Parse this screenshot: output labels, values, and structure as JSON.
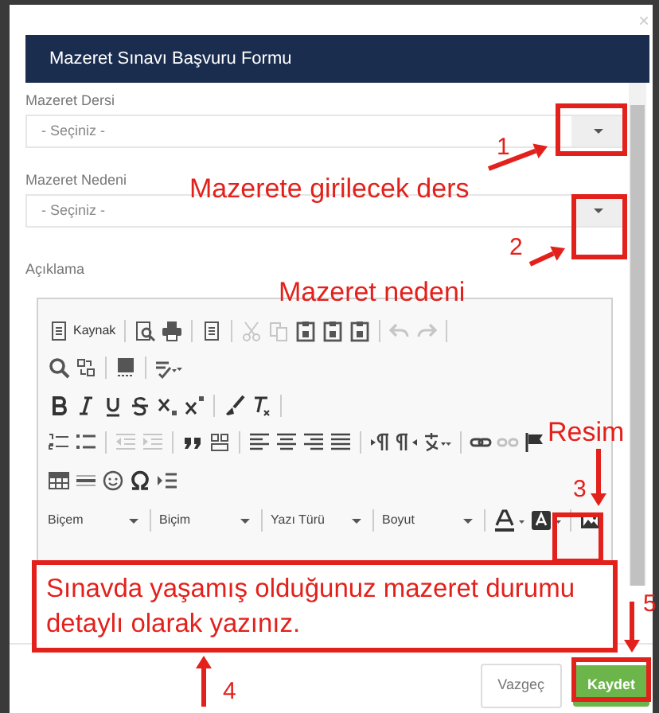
{
  "modal": {
    "close": "×",
    "title": "Mazeret Sınavı Başvuru Formu"
  },
  "fields": [
    {
      "label": "Mazeret Dersi",
      "placeholder": "- Seçiniz -"
    },
    {
      "label": "Mazeret Nedeni",
      "placeholder": "- Seçiniz -"
    }
  ],
  "editor": {
    "label": "Açıklama",
    "toolbar": [
      {
        "items": [
          {
            "kind": "button",
            "label": "Kaynak",
            "disabled": false
          },
          {
            "kind": "sep"
          },
          {
            "kind": "icon",
            "disabled": false
          },
          {
            "kind": "icon",
            "disabled": false
          },
          {
            "kind": "sep"
          },
          {
            "kind": "icon",
            "disabled": false
          },
          {
            "kind": "sep"
          },
          {
            "kind": "icon",
            "disabled": true
          },
          {
            "kind": "icon",
            "disabled": true
          },
          {
            "kind": "icon",
            "disabled": false
          },
          {
            "kind": "icon",
            "disabled": false
          },
          {
            "kind": "icon",
            "disabled": false
          },
          {
            "kind": "sep"
          },
          {
            "kind": "icon",
            "disabled": true
          },
          {
            "kind": "icon",
            "disabled": true
          },
          {
            "kind": "sep"
          }
        ]
      },
      {
        "items": [
          {
            "kind": "icon",
            "disabled": false
          },
          {
            "kind": "icon",
            "disabled": false
          },
          {
            "kind": "sep"
          },
          {
            "kind": "icon",
            "disabled": false
          },
          {
            "kind": "sep"
          },
          {
            "kind": "icon",
            "disabled": false
          }
        ]
      },
      {
        "items": [
          {
            "kind": "icon",
            "disabled": false
          },
          {
            "kind": "icon",
            "disabled": false
          },
          {
            "kind": "icon",
            "disabled": false
          },
          {
            "kind": "icon",
            "disabled": false
          },
          {
            "kind": "icon",
            "disabled": false
          },
          {
            "kind": "icon",
            "disabled": false
          },
          {
            "kind": "sep"
          },
          {
            "kind": "icon",
            "disabled": false
          },
          {
            "kind": "icon",
            "disabled": false
          },
          {
            "kind": "sep"
          }
        ]
      },
      {
        "items": [
          {
            "kind": "icon",
            "disabled": false
          },
          {
            "kind": "icon",
            "disabled": false
          },
          {
            "kind": "sep"
          },
          {
            "kind": "icon",
            "disabled": true
          },
          {
            "kind": "icon",
            "disabled": true
          },
          {
            "kind": "sep"
          },
          {
            "kind": "icon",
            "disabled": false
          },
          {
            "kind": "icon",
            "disabled": false
          },
          {
            "kind": "sep"
          },
          {
            "kind": "icon",
            "disabled": false
          },
          {
            "kind": "icon",
            "disabled": false
          },
          {
            "kind": "icon",
            "disabled": false
          },
          {
            "kind": "icon",
            "disabled": false
          },
          {
            "kind": "sep"
          },
          {
            "kind": "icon",
            "disabled": false
          },
          {
            "kind": "icon",
            "disabled": false
          },
          {
            "kind": "icon",
            "disabled": false
          },
          {
            "kind": "sep"
          },
          {
            "kind": "icon",
            "disabled": false
          },
          {
            "kind": "icon",
            "disabled": true
          },
          {
            "kind": "icon",
            "disabled": false
          }
        ]
      },
      {
        "items": [
          {
            "kind": "icon",
            "disabled": false
          },
          {
            "kind": "icon",
            "disabled": false
          },
          {
            "kind": "icon",
            "disabled": false
          },
          {
            "kind": "icon",
            "disabled": false
          },
          {
            "kind": "icon",
            "disabled": false
          }
        ]
      },
      {
        "items": [
          {
            "kind": "combo",
            "label": "Biçem"
          },
          {
            "kind": "sep"
          },
          {
            "kind": "combo",
            "label": "Biçim"
          },
          {
            "kind": "sep"
          },
          {
            "kind": "combo",
            "label": "Yazı Türü"
          },
          {
            "kind": "sep"
          },
          {
            "kind": "combo",
            "label": "Boyut"
          },
          {
            "kind": "sep"
          },
          {
            "kind": "icon",
            "disabled": false
          },
          {
            "kind": "icon",
            "disabled": false
          },
          {
            "kind": "sep"
          },
          {
            "kind": "icon",
            "disabled": false
          }
        ]
      }
    ]
  },
  "buttons": [
    {
      "label": "Vazgeç",
      "kind": "secondary"
    },
    {
      "label": "Kaydet",
      "kind": "primary"
    }
  ],
  "annotations": {
    "labels": [
      "Mazerete girilecek ders",
      "Mazeret nedeni",
      "Resim"
    ],
    "numbers": [
      "1",
      "2",
      "3",
      "4",
      "5"
    ],
    "note": "Sınavda yaşamış olduğunuz mazeret durumu detaylı olarak yazınız."
  }
}
